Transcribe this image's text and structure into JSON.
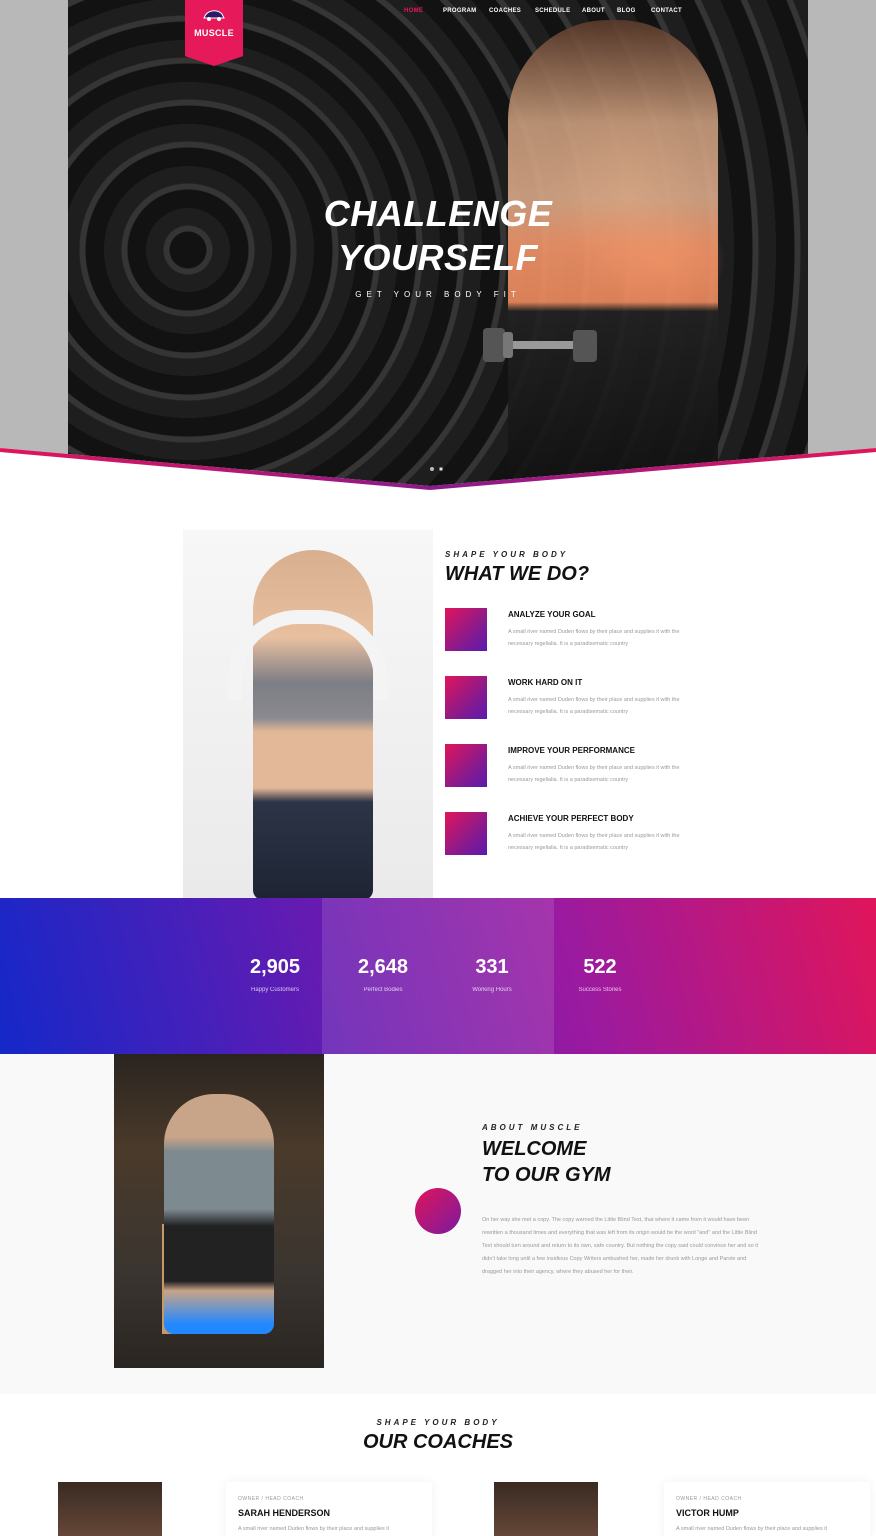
{
  "brand": {
    "logo_text": "MUSCLE",
    "accent": "#e6195a"
  },
  "nav": {
    "items": [
      "HOME",
      "PROGRAM",
      "COACHES",
      "SCHEDULE",
      "ABOUT",
      "BLOG",
      "CONTACT"
    ],
    "active": "HOME"
  },
  "hero": {
    "title_line1": "CHALLENGE",
    "title_line2": "YOURSELF",
    "subtitle": "GET YOUR BODY FIT"
  },
  "what_we_do": {
    "kicker": "SHAPE YOUR BODY",
    "title": "WHAT WE DO?",
    "items": [
      {
        "title": "ANALYZE YOUR GOAL",
        "text": "A small river named Duden flows by their place and supplies it with the necessary regelialia. It is a paradisematic country"
      },
      {
        "title": "WORK HARD ON IT",
        "text": "A small river named Duden flows by their place and supplies it with the necessary regelialia. It is a paradisematic country"
      },
      {
        "title": "IMPROVE YOUR PERFORMANCE",
        "text": "A small river named Duden flows by their place and supplies it with the necessary regelialia. It is a paradisematic country"
      },
      {
        "title": "ACHIEVE YOUR PERFECT BODY",
        "text": "A small river named Duden flows by their place and supplies it with the necessary regelialia. It is a paradisematic country"
      }
    ]
  },
  "stats": [
    {
      "value": "2,905",
      "label": "Happy Customers"
    },
    {
      "value": "2,648",
      "label": "Perfect Bodies"
    },
    {
      "value": "331",
      "label": "Working Hours"
    },
    {
      "value": "522",
      "label": "Success Stories"
    }
  ],
  "about": {
    "kicker": "ABOUT MUSCLE",
    "title_line1": "WELCOME",
    "title_line2": "TO OUR GYM",
    "text": "On her way she met a copy. The copy warned the Little Blind Text, that where it came from it would have been rewritten a thousand times and everything that was left from its origin would be the word \"and\" and the Little Blind Text should turn around and return to its own, safe country. But nothing the copy said could convince her and so it didn't take long until a few insidious Copy Writers ambushed her, made her drunk with Longe and Parole and dragged her into their agency, where they abused her for their."
  },
  "coaches": {
    "kicker": "SHAPE YOUR BODY",
    "title": "OUR COACHES",
    "items": [
      {
        "role": "OWNER / HEAD COACH",
        "name": "SARAH HENDERSON",
        "text": "A small river named Duden flows by their place and supplies it"
      },
      {
        "role": "OWNER / HEAD COACH",
        "name": "VICTOR HUMP",
        "text": "A small river named Duden flows by their place and supplies it"
      }
    ]
  }
}
